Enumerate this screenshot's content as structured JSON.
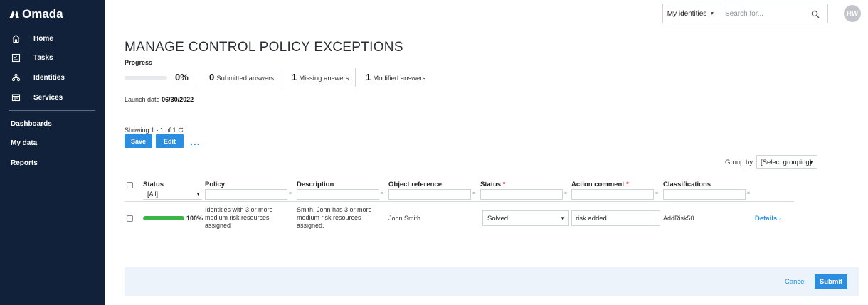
{
  "brand": {
    "name": "Omada"
  },
  "sidebar": {
    "items": [
      {
        "label": "Home",
        "icon": "home-icon"
      },
      {
        "label": "Tasks",
        "icon": "tasks-icon"
      },
      {
        "label": "Identities",
        "icon": "identities-icon"
      },
      {
        "label": "Services",
        "icon": "services-icon"
      }
    ],
    "links": [
      "Dashboards",
      "My data",
      "Reports"
    ]
  },
  "topbar": {
    "scope_select": "My identities",
    "search_placeholder": "Search for...",
    "avatar_initials": "RW"
  },
  "page": {
    "title": "MANAGE CONTROL POLICY EXCEPTIONS",
    "progress_label": "Progress",
    "progress_value": 0,
    "progress_text": "0%",
    "stats": [
      {
        "count": "0",
        "label": "Submitted answers"
      },
      {
        "count": "1",
        "label": "Missing answers"
      },
      {
        "count": "1",
        "label": "Modified answers"
      }
    ],
    "launch_label": "Launch date",
    "launch_date": "06/30/2022",
    "showing": "Showing 1 - 1 of 1",
    "save_label": "Save",
    "edit_label": "Edit",
    "more_label": "...",
    "group_by_label": "Group by:",
    "group_by_value": "[Select grouping]"
  },
  "table": {
    "columns": {
      "status": "Status",
      "policy": "Policy",
      "description": "Description",
      "object_reference": "Object reference",
      "status2": "Status",
      "action_comment": "Action comment",
      "classifications": "Classifications"
    },
    "required_mark": "*",
    "status_filter": "[All]",
    "filter_clear": "×",
    "rows": [
      {
        "progress_value": 100,
        "progress_text": "100%",
        "policy": [
          "Identities with 3 or more",
          "medium risk resources",
          "assigned"
        ],
        "description": [
          "Smith, John has 3 or more",
          "medium risk resources",
          "assigned."
        ],
        "object_reference": "John Smith",
        "status": "Solved",
        "action_comment": "risk added",
        "classification": "AddRisk50",
        "details": "Details"
      }
    ]
  },
  "footer": {
    "cancel_label": "Cancel",
    "submit_label": "Submit"
  },
  "colors": {
    "sidebar": "#12213a",
    "accent": "#2b8ee0",
    "progress_fill": "#3cb44a",
    "footer_bg": "#ecf3fb",
    "required": "#e0323a"
  }
}
